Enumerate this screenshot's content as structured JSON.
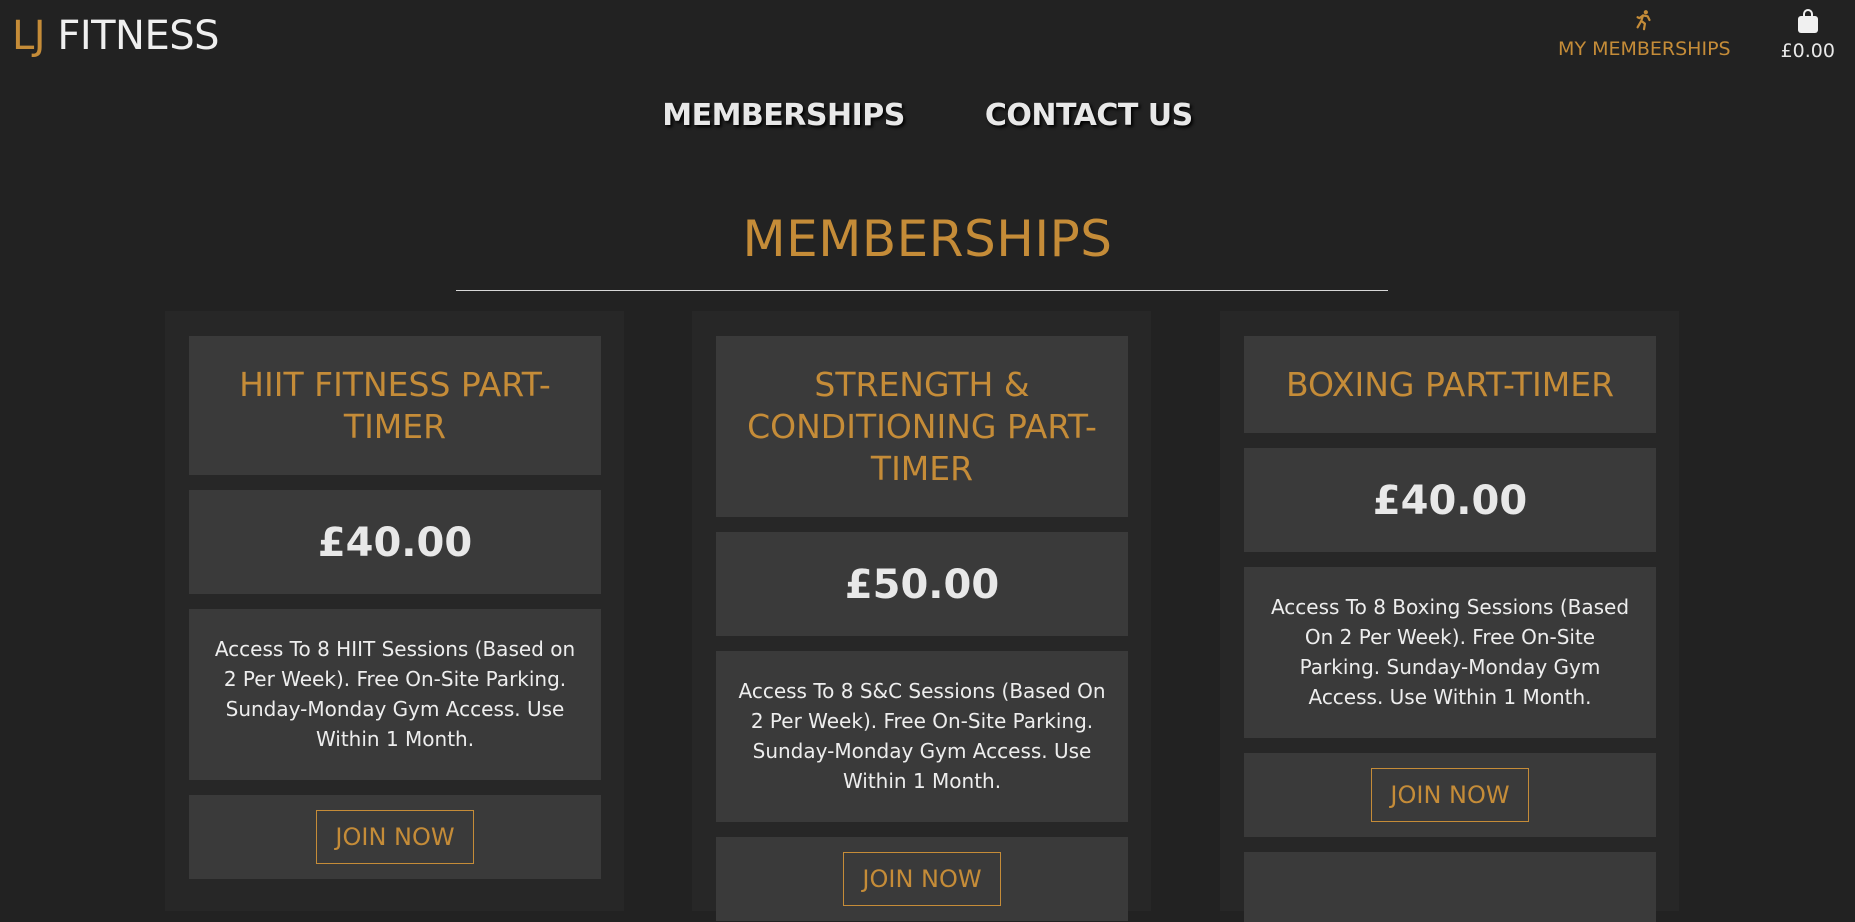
{
  "brand": {
    "prefix": "LJ",
    "name": "FITNESS"
  },
  "header": {
    "account_label": "MY MEMBERSHIPS",
    "bag_total": "£0.00"
  },
  "nav": {
    "items": [
      "MEMBERSHIPS",
      "CONTACT US"
    ]
  },
  "page": {
    "title": "MEMBERSHIPS"
  },
  "cards": [
    {
      "title": "HIIT FITNESS PART-TIMER",
      "price": "£40.00",
      "description": "Access To 8 HIIT Sessions (Based on 2 Per Week). Free On-Site Parking. Sunday-Monday Gym Access. Use Within 1 Month.",
      "button": "JOIN NOW"
    },
    {
      "title": "STRENGTH & CONDITIONING PART-TIMER",
      "price": "£50.00",
      "description": "Access To 8 S&C Sessions (Based On 2 Per Week). Free On-Site Parking. Sunday-Monday Gym Access. Use Within 1 Month.",
      "button": "JOIN NOW"
    },
    {
      "title": "BOXING PART-TIMER",
      "price": "£40.00",
      "description": "Access To 8 Boxing Sessions (Based On 2 Per Week). Free On-Site Parking. Sunday-Monday Gym Access. Use Within 1 Month.",
      "button": "JOIN NOW"
    }
  ],
  "colors": {
    "accent": "#c58c38",
    "background": "#222222",
    "card": "#3a3a3a"
  },
  "icons": {
    "account": "running-person-icon",
    "bag": "shopping-bag-icon"
  }
}
